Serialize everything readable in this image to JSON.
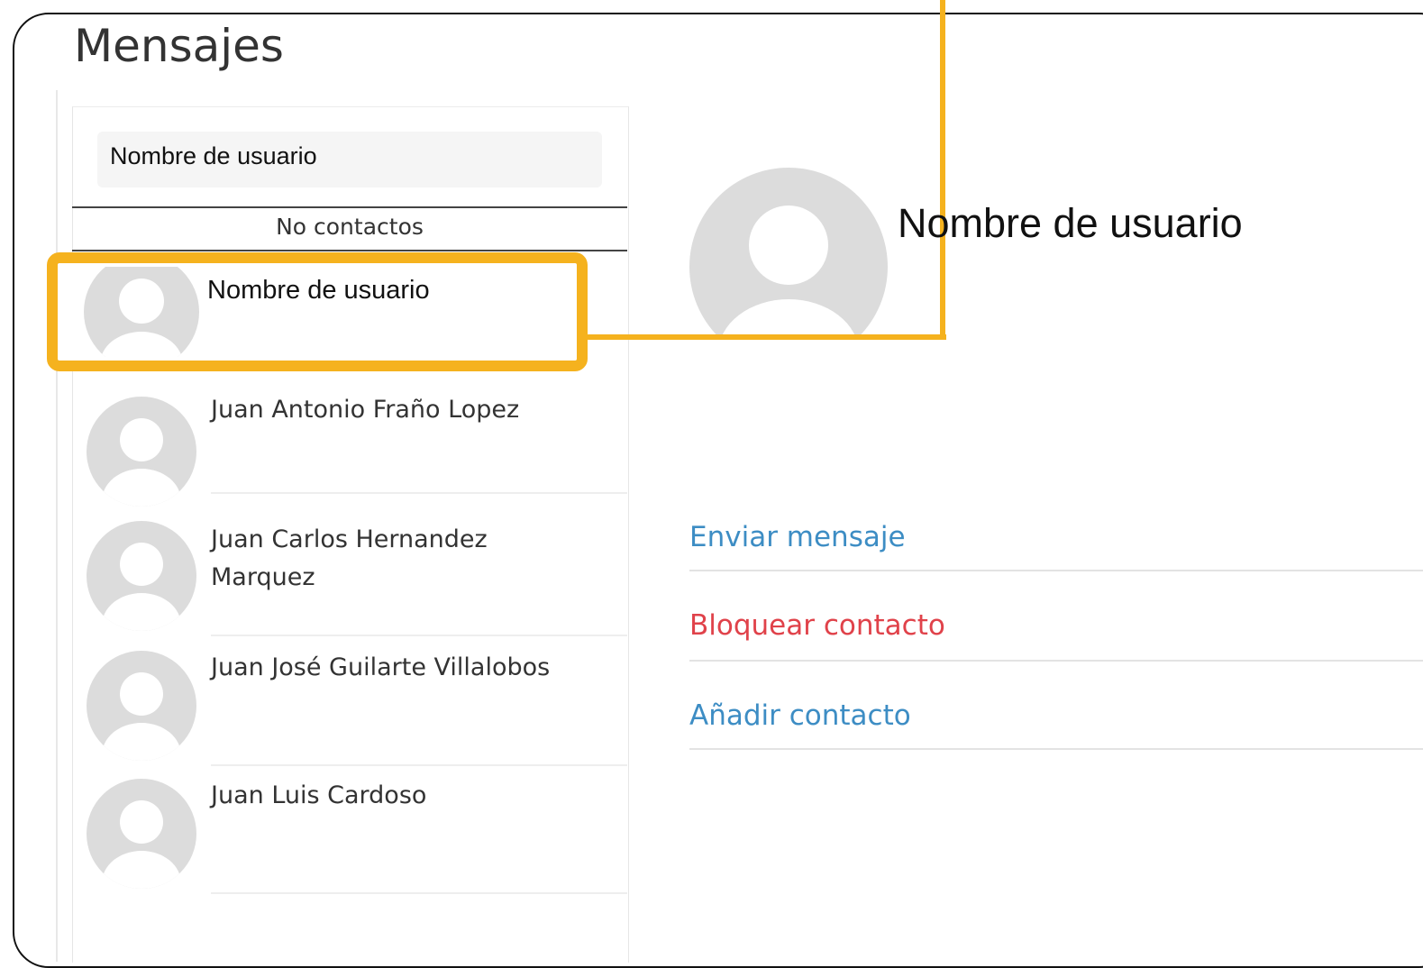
{
  "page": {
    "title": "Mensajes"
  },
  "sidebar": {
    "search_text": "Nombre de usuario",
    "no_contacts_label": "No contactos",
    "highlighted_contact": "Nombre de usuario",
    "contacts": [
      {
        "name": "Juan Antonio Fraño Lopez"
      },
      {
        "name": "Juan Carlos Hernandez Marquez"
      },
      {
        "name": "Juan José Guilarte Villalobos"
      },
      {
        "name": "Juan Luis Cardoso"
      }
    ]
  },
  "profile": {
    "name": "Nombre de usuario",
    "actions": {
      "send": "Enviar mensaje",
      "block": "Bloquear contacto",
      "add": "Añadir contacto"
    }
  },
  "colors": {
    "highlight": "#f5b21e",
    "link_blue": "#3d8dc4",
    "danger_red": "#e0424a",
    "avatar_gray": "#e0e0e0"
  },
  "icons": {
    "avatar": "user-avatar-icon"
  }
}
